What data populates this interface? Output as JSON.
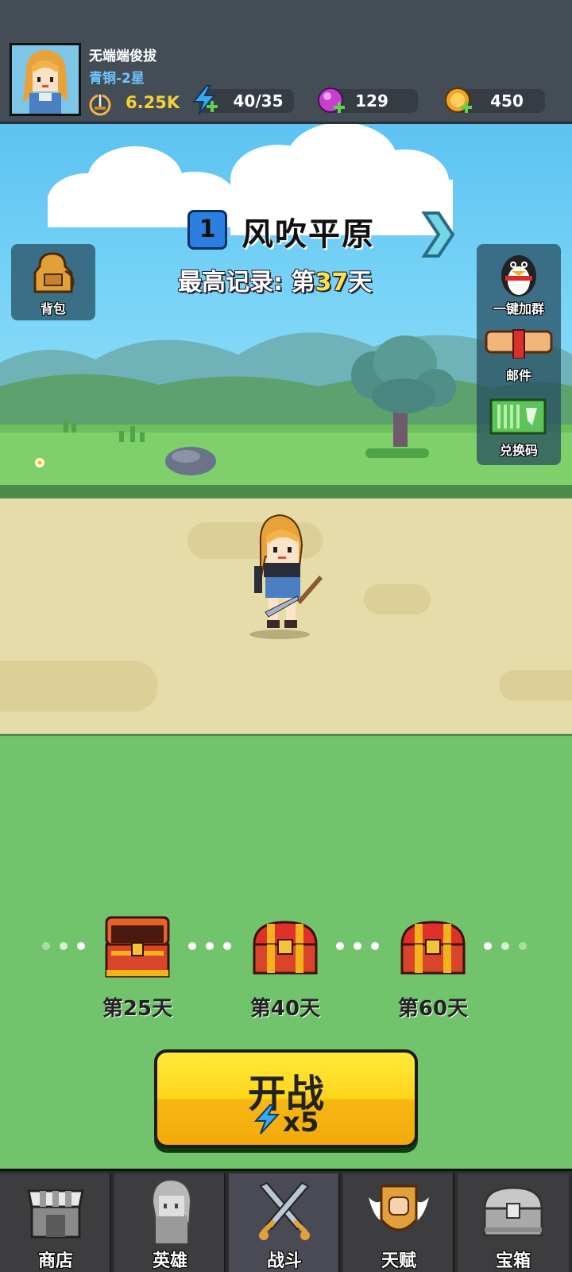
{
  "player": {
    "name": "无端端俊拔",
    "rank": "青铜-2星",
    "power": "6.25K"
  },
  "resources": {
    "energy": "40/35",
    "gems": "129",
    "coins": "450"
  },
  "stage": {
    "number": "1",
    "name": "风吹平原",
    "best_record_prefix": "最高记录: 第",
    "best_record_day": "37",
    "best_record_suffix": "天"
  },
  "side_buttons": {
    "backpack": "背包",
    "join_group": "一键加群",
    "mail": "邮件",
    "redeem_code": "兑换码"
  },
  "rewards": [
    {
      "label": "第25天",
      "opened": true
    },
    {
      "label": "第40天",
      "opened": false
    },
    {
      "label": "第60天",
      "opened": false
    }
  ],
  "start_button": {
    "label": "开战",
    "cost": "x5"
  },
  "nav": {
    "tabs": [
      {
        "label": "商店",
        "icon": "shop-icon"
      },
      {
        "label": "英雄",
        "icon": "hero-icon"
      },
      {
        "label": "战斗",
        "icon": "swords-icon",
        "active": true
      },
      {
        "label": "天赋",
        "icon": "talent-fist-icon"
      },
      {
        "label": "宝箱",
        "icon": "treasure-chest-icon"
      }
    ]
  },
  "colors": {
    "header_bg": "#444d55",
    "grass": "#72c46c",
    "path": "#e6dcaa",
    "button_yellow": "#ffd51c",
    "record_day": "#ffe14a",
    "rank_blue": "#6ec6ff"
  }
}
